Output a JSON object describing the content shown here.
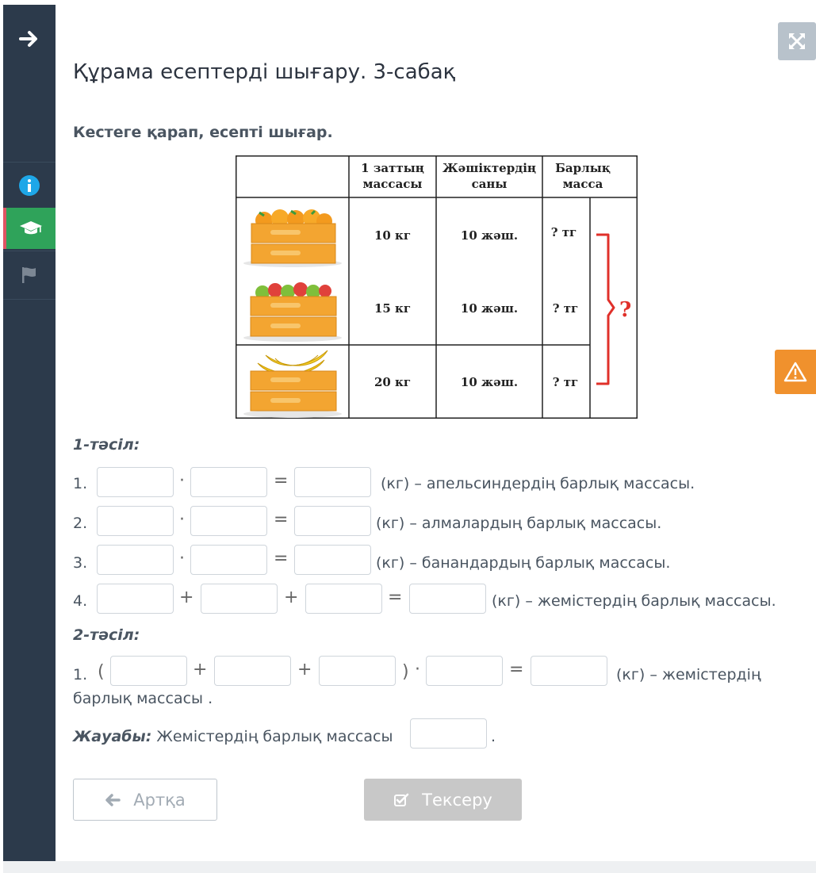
{
  "page": {
    "title": "Құрама есептерді шығару. 3-сабақ",
    "instruction": "Кестеге қарап, есепті шығар."
  },
  "sidebar": {
    "icons": [
      "arrow-right-icon",
      "info-icon",
      "graduation-cap-icon",
      "flag-icon"
    ],
    "active_color": "#2fa35a"
  },
  "table": {
    "headers": [
      "1 заттың массасы",
      "Жәшіктердің саны",
      "Барлық масса"
    ],
    "header_lines": [
      [
        "1 заттың",
        "массасы"
      ],
      [
        "Жәшіктердің",
        "саны"
      ],
      [
        "Барлық",
        "масса"
      ]
    ],
    "rows": [
      {
        "fruit": "orange-crate-image",
        "mass": "10 кг",
        "boxes": "10 жәш.",
        "total": "? тг"
      },
      {
        "fruit": "apple-crate-image",
        "mass": "15 кг",
        "boxes": "10 жәш.",
        "total": "? тг"
      },
      {
        "fruit": "banana-crate-image",
        "mass": "20 кг",
        "boxes": "10 жәш.",
        "total": "? тг"
      }
    ],
    "brace_mark": "?"
  },
  "method1": {
    "label": "1-тәсіл:",
    "lines": [
      {
        "num": "1.",
        "op1": "·",
        "eq": "=",
        "desc": "(кг) – апельсиндердің барлық массасы."
      },
      {
        "num": "2.",
        "op1": "·",
        "eq": "=",
        "desc": "(кг) – алмалардың барлық массасы."
      },
      {
        "num": "3.",
        "op1": "·",
        "eq": "=",
        "desc": "(кг) – банандардың барлық массасы."
      },
      {
        "num": "4.",
        "op1": "+",
        "op2": "+",
        "eq": "=",
        "desc": "(кг) – жемістердің барлық массасы."
      }
    ]
  },
  "method2": {
    "label": "2-тәсіл:",
    "num": "1.",
    "open_paren": "(",
    "plus": "+",
    "close_paren": ")",
    "dot": "·",
    "eq": "=",
    "desc_line1": "(кг) – жемістердің",
    "desc_line2": "барлық массасы ."
  },
  "answer": {
    "label": "Жауабы:",
    "text": "Жемістердің барлық массасы",
    "end": "."
  },
  "buttons": {
    "back_label": "Артқа",
    "check_label": "Тексеру"
  }
}
